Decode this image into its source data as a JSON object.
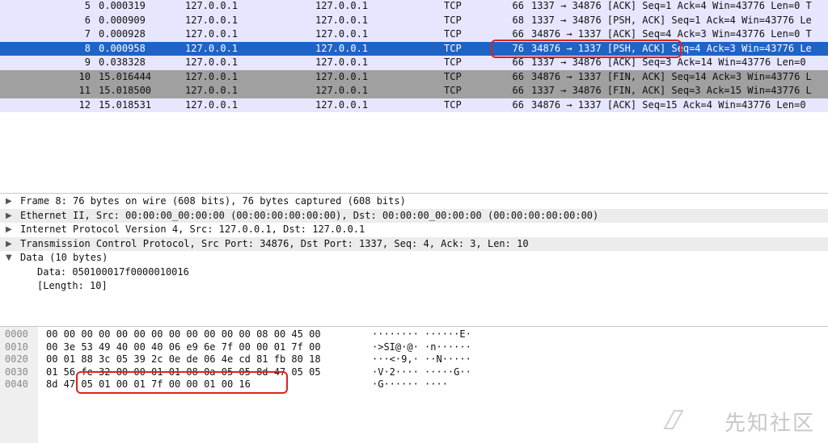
{
  "packets": [
    {
      "no": "5",
      "time": "0.000319",
      "src": "127.0.0.1",
      "dst": "127.0.0.1",
      "proto": "TCP",
      "len": "66",
      "info": "1337 → 34876 [ACK] Seq=1 Ack=4 Win=43776 Len=0 T",
      "style": "tcp"
    },
    {
      "no": "6",
      "time": "0.000909",
      "src": "127.0.0.1",
      "dst": "127.0.0.1",
      "proto": "TCP",
      "len": "68",
      "info": "1337 → 34876 [PSH, ACK] Seq=1 Ack=4 Win=43776 Le",
      "style": "tcp"
    },
    {
      "no": "7",
      "time": "0.000928",
      "src": "127.0.0.1",
      "dst": "127.0.0.1",
      "proto": "TCP",
      "len": "66",
      "info": "34876 → 1337 [ACK] Seq=4 Ack=3 Win=43776 Len=0 T",
      "style": "tcp"
    },
    {
      "no": "8",
      "time": "0.000958",
      "src": "127.0.0.1",
      "dst": "127.0.0.1",
      "proto": "TCP",
      "len": "76",
      "info": "34876 → 1337 [PSH, ACK] Seq=4 Ack=3 Win=43776 Le",
      "style": "sel"
    },
    {
      "no": "9",
      "time": "0.038328",
      "src": "127.0.0.1",
      "dst": "127.0.0.1",
      "proto": "TCP",
      "len": "66",
      "info": "1337 → 34876 [ACK] Seq=3 Ack=14 Win=43776 Len=0",
      "style": "tcp"
    },
    {
      "no": "10",
      "time": "15.016444",
      "src": "127.0.0.1",
      "dst": "127.0.0.1",
      "proto": "TCP",
      "len": "66",
      "info": "34876 → 1337 [FIN, ACK] Seq=14 Ack=3 Win=43776 L",
      "style": "fin"
    },
    {
      "no": "11",
      "time": "15.018500",
      "src": "127.0.0.1",
      "dst": "127.0.0.1",
      "proto": "TCP",
      "len": "66",
      "info": "1337 → 34876 [FIN, ACK] Seq=3 Ack=15 Win=43776 L",
      "style": "fin"
    },
    {
      "no": "12",
      "time": "15.018531",
      "src": "127.0.0.1",
      "dst": "127.0.0.1",
      "proto": "TCP",
      "len": "66",
      "info": "34876 → 1337 [ACK] Seq=15 Ack=4 Win=43776 Len=0",
      "style": "tcp"
    }
  ],
  "details": [
    {
      "text": "Frame 8: 76 bytes on wire (608 bits), 76 bytes captured (608 bits)",
      "expanded": false,
      "level": 0
    },
    {
      "text": "Ethernet II, Src: 00:00:00_00:00:00 (00:00:00:00:00:00), Dst: 00:00:00_00:00:00 (00:00:00:00:00:00)",
      "expanded": false,
      "level": 0
    },
    {
      "text": "Internet Protocol Version 4, Src: 127.0.0.1, Dst: 127.0.0.1",
      "expanded": false,
      "level": 0
    },
    {
      "text": "Transmission Control Protocol, Src Port: 34876, Dst Port: 1337, Seq: 4, Ack: 3, Len: 10",
      "expanded": false,
      "level": 0
    },
    {
      "text": "Data (10 bytes)",
      "expanded": true,
      "level": 0
    },
    {
      "text": "Data: 050100017f0000010016",
      "expanded": false,
      "level": 1
    },
    {
      "text": "[Length: 10]",
      "expanded": false,
      "level": 1
    }
  ],
  "bytes": [
    {
      "offset": "0000",
      "hex": "00 00 00 00 00 00 00 00  00 00 00 00 08 00 45 00",
      "ascii": "········ ······E·"
    },
    {
      "offset": "0010",
      "hex": "00 3e 53 49 40 00 40 06  e9 6e 7f 00 00 01 7f 00",
      "ascii": "·>SI@·@· ·n······"
    },
    {
      "offset": "0020",
      "hex": "00 01 88 3c 05 39 2c 0e  de 06 4e cd 81 fb 80 18",
      "ascii": "···<·9,· ··N·····"
    },
    {
      "offset": "0030",
      "hex": "01 56 fe 32 00 00 01 01  08 0a 05 05 8d 47 05 05",
      "ascii": "·V·2···· ·····G··"
    },
    {
      "offset": "0040",
      "hex": "8d 47 05 01 00 01 7f 00  00 01 00 16",
      "ascii": "·G······ ····"
    }
  ],
  "icons": {
    "collapsed": "triangle-right-icon",
    "expanded": "triangle-down-icon"
  },
  "colors": {
    "tcp_row": "#e7e6ff",
    "fin_row": "#a0a0a0",
    "selected_row": "#1e63c6",
    "highlight_box": "#e02020"
  },
  "watermark": "先知社区"
}
